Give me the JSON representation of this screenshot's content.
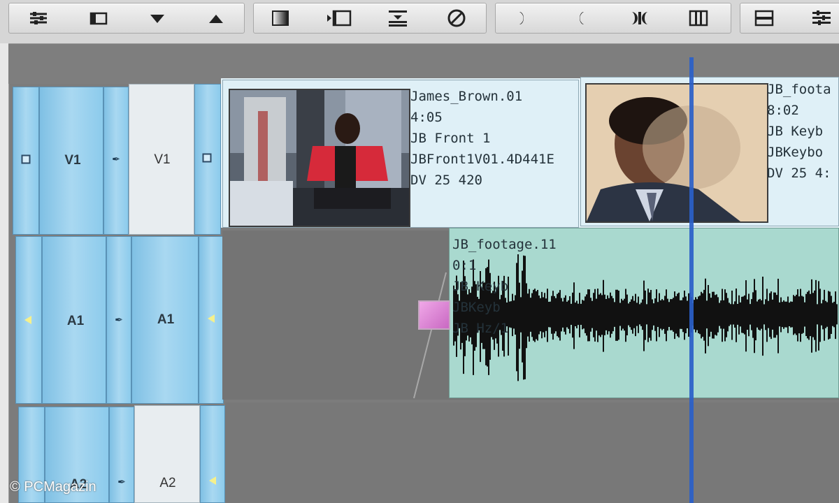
{
  "toolbar": {
    "buttons": [
      "sliders-icon",
      "folder-icon",
      "triangle-down-icon",
      "triangle-up-icon",
      "gradient-icon",
      "trim-in-icon",
      "lift-icon",
      "no-icon",
      "half-moon-right-icon",
      "half-moon-left-icon",
      "split-icon",
      "columns-icon",
      "rows-icon",
      "tracks-icon"
    ]
  },
  "tracks": {
    "v1": {
      "source_label": "V1",
      "record_label": "V1"
    },
    "a1": {
      "source_label": "A1",
      "record_label": "A1"
    },
    "a2": {
      "source_label": "A2",
      "record_label": "A2"
    }
  },
  "clips": {
    "clip1": {
      "name": "James_Brown.01",
      "duration": "4:05",
      "tape": "JB Front 1",
      "file": "JBFront1V01.4D441E",
      "format": "DV 25 420"
    },
    "clip2": {
      "name": "JB_foota",
      "duration": "8:02",
      "tape": "JB Keyb",
      "file": "JBKeybo",
      "format": "DV 25 4:"
    },
    "audio": {
      "name": "JB_footage.11",
      "duration": "0:1",
      "tape": "JB Keyb",
      "file": "JBKeyb",
      "format": "JB Hz/1"
    }
  },
  "watermark": "© PCMagazin",
  "colors": {
    "track_blue": "#8ccbec",
    "audio_clip": "#a9d9cf",
    "playhead": "#2a5fc9",
    "video_clip_bg": "#dff0f7"
  }
}
